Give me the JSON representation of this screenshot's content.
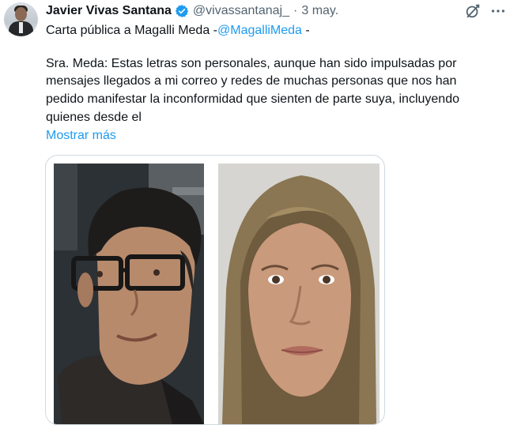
{
  "tweet": {
    "author_name": "Javier Vivas Santana",
    "author_handle": "@vivassantanaj_",
    "separator": "·",
    "date": "3 may.",
    "line1_prefix": "Carta pública a Magalli Meda -",
    "line1_mention": "@MagalliMeda",
    "line1_suffix": " -",
    "body_lines": [
      "Sra. Meda: Estas letras son personales, aunque han sido impulsadas por",
      "mensajes llegados a mi correo y redes de muchas personas que nos han",
      "pedido manifestar la inconformidad que sienten de parte suya, incluyendo",
      "quienes desde el"
    ],
    "show_more": "Mostrar más"
  },
  "icons": {
    "verified": "verified-badge-icon",
    "grok": "grok-icon",
    "more": "more-options-icon"
  },
  "colors": {
    "accent": "#1d9bf0",
    "secondary_text": "#536471",
    "primary_text": "#0f1419"
  }
}
